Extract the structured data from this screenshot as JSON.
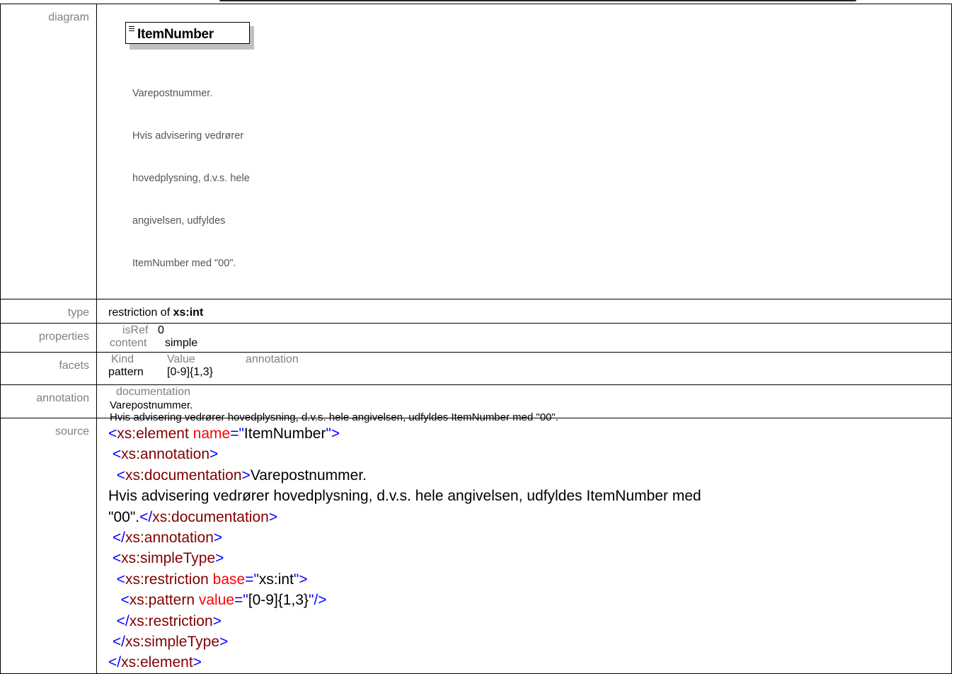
{
  "labels": {
    "diagram": "diagram",
    "type": "type",
    "properties": "properties",
    "facets": "facets",
    "annotation": "annotation",
    "source": "source"
  },
  "diagram": {
    "element_name": "ItemNumber",
    "doc_lines": [
      "Varepostnummer.",
      "Hvis advisering vedrører",
      "hovedplysning, d.v.s. hele",
      "angivelsen, udfyldes",
      "ItemNumber med \"00\"."
    ]
  },
  "type": {
    "prefix": "restriction of",
    "base": "xs:int"
  },
  "properties": {
    "isref_key": "isRef",
    "isref_value": "0",
    "content_key": "content",
    "content_value": "simple"
  },
  "facets": {
    "headers": [
      "Kind",
      "Value",
      "annotation"
    ],
    "rows": [
      {
        "kind": "pattern",
        "value": "[0-9]{1,3}",
        "annotation": ""
      }
    ]
  },
  "annotation": {
    "header": "documentation",
    "line1": "Varepostnummer.",
    "line2": "Hvis advisering vedrører hovedplysning, d.v.s. hele angivelsen, udfyldes ItemNumber med \"00\"."
  },
  "source": {
    "lines": [
      [
        [
          "b",
          "<"
        ],
        [
          "t",
          "xs:element"
        ],
        [
          "x",
          " "
        ],
        [
          "a",
          "name"
        ],
        [
          "b",
          "=\""
        ],
        [
          "x",
          "ItemNumber"
        ],
        [
          "b",
          "\">"
        ]
      ],
      [
        [
          "x",
          " "
        ],
        [
          "b",
          "<"
        ],
        [
          "t",
          "xs:annotation"
        ],
        [
          "b",
          ">"
        ]
      ],
      [
        [
          "x",
          "  "
        ],
        [
          "b",
          "<"
        ],
        [
          "t",
          "xs:documentation"
        ],
        [
          "b",
          ">"
        ],
        [
          "x",
          "Varepostnummer."
        ]
      ],
      [
        [
          "x",
          "Hvis advisering vedrører hovedplysning, d.v.s. hele angivelsen, udfyldes ItemNumber med"
        ]
      ],
      [
        [
          "x",
          "\"00\"."
        ],
        [
          "b",
          "</"
        ],
        [
          "t",
          "xs:documentation"
        ],
        [
          "b",
          ">"
        ]
      ],
      [
        [
          "x",
          " "
        ],
        [
          "b",
          "</"
        ],
        [
          "t",
          "xs:annotation"
        ],
        [
          "b",
          ">"
        ]
      ],
      [
        [
          "x",
          " "
        ],
        [
          "b",
          "<"
        ],
        [
          "t",
          "xs:simpleType"
        ],
        [
          "b",
          ">"
        ]
      ],
      [
        [
          "x",
          "  "
        ],
        [
          "b",
          "<"
        ],
        [
          "t",
          "xs:restriction"
        ],
        [
          "x",
          " "
        ],
        [
          "a",
          "base"
        ],
        [
          "b",
          "=\""
        ],
        [
          "x",
          "xs:int"
        ],
        [
          "b",
          "\">"
        ]
      ],
      [
        [
          "x",
          "   "
        ],
        [
          "b",
          "<"
        ],
        [
          "t",
          "xs:pattern"
        ],
        [
          "x",
          " "
        ],
        [
          "a",
          "value"
        ],
        [
          "b",
          "=\""
        ],
        [
          "x",
          "[0-9]{1,3}"
        ],
        [
          "b",
          "\"/>"
        ]
      ],
      [
        [
          "x",
          "  "
        ],
        [
          "b",
          "</"
        ],
        [
          "t",
          "xs:restriction"
        ],
        [
          "b",
          ">"
        ]
      ],
      [
        [
          "x",
          " "
        ],
        [
          "b",
          "</"
        ],
        [
          "t",
          "xs:simpleType"
        ],
        [
          "b",
          ">"
        ]
      ],
      [
        [
          "b",
          "</"
        ],
        [
          "t",
          "xs:element"
        ],
        [
          "b",
          ">"
        ]
      ]
    ]
  },
  "colors": {
    "label_gray": "#808080",
    "markup_blue": "#0000ff",
    "tag_maroon": "#800000",
    "attr_red": "#ff0000"
  }
}
